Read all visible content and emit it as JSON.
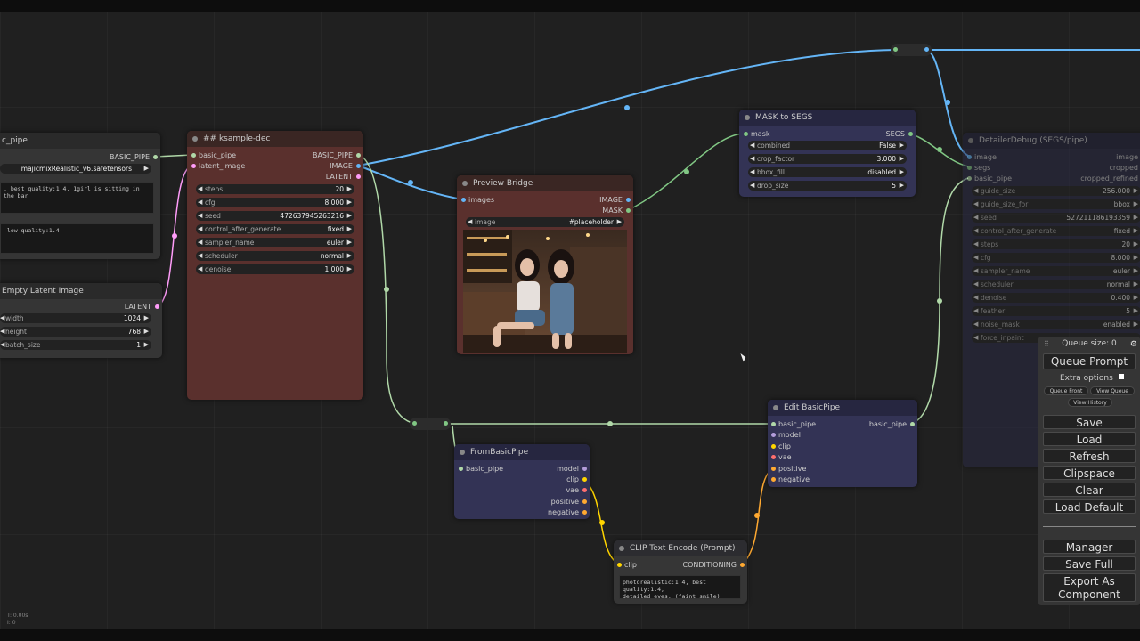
{
  "nodes": {
    "basic_pipe_loader": {
      "title": "c_pipe",
      "output": "BASIC_PIPE",
      "ckpt": "majicmixRealistic_v6.safetensors",
      "positive_text": ", best quality:1.4, 1girl is sitting in the bar",
      "negative_text": " low quality:1.4"
    },
    "empty_latent": {
      "title": "Empty Latent Image",
      "output": "LATENT",
      "widgets": [
        {
          "label": "width",
          "value": "1024"
        },
        {
          "label": "height",
          "value": "768"
        },
        {
          "label": "batch_size",
          "value": "1"
        }
      ]
    },
    "ksampler": {
      "title": "## ksample-dec",
      "inputs": [
        "basic_pipe",
        "latent_image"
      ],
      "outputs": [
        "BASIC_PIPE",
        "IMAGE",
        "LATENT"
      ],
      "widgets": [
        {
          "label": "steps",
          "value": "20"
        },
        {
          "label": "cfg",
          "value": "8.000"
        },
        {
          "label": "seed",
          "value": "472637945263216"
        },
        {
          "label": "control_after_generate",
          "value": "fixed"
        },
        {
          "label": "sampler_name",
          "value": "euler"
        },
        {
          "label": "scheduler",
          "value": "normal"
        },
        {
          "label": "denoise",
          "value": "1.000"
        }
      ]
    },
    "preview_bridge": {
      "title": "Preview Bridge",
      "input": "images",
      "outputs": [
        "IMAGE",
        "MASK"
      ],
      "image_label": "image",
      "image_value": "#placeholder"
    },
    "mask_to_segs": {
      "title": "MASK to SEGS",
      "input": "mask",
      "output": "SEGS",
      "widgets": [
        {
          "label": "combined",
          "value": "False"
        },
        {
          "label": "crop_factor",
          "value": "3.000"
        },
        {
          "label": "bbox_fill",
          "value": "disabled"
        },
        {
          "label": "drop_size",
          "value": "5"
        }
      ]
    },
    "detailer": {
      "title": "DetailerDebug (SEGS/pipe)",
      "inputs": [
        "image",
        "segs",
        "basic_pipe"
      ],
      "outputs": [
        "image",
        "cropped",
        "cropped_refined"
      ],
      "widgets": [
        {
          "label": "guide_size",
          "value": "256.000"
        },
        {
          "label": "guide_size_for",
          "value": "bbox"
        },
        {
          "label": "seed",
          "value": "527211186193359"
        },
        {
          "label": "control_after_generate",
          "value": "fixed"
        },
        {
          "label": "steps",
          "value": "20"
        },
        {
          "label": "cfg",
          "value": "8.000"
        },
        {
          "label": "sampler_name",
          "value": "euler"
        },
        {
          "label": "scheduler",
          "value": "normal"
        },
        {
          "label": "denoise",
          "value": "0.400"
        },
        {
          "label": "feather",
          "value": "5"
        },
        {
          "label": "noise_mask",
          "value": "enabled"
        },
        {
          "label": "force_inpaint",
          "value": ""
        }
      ]
    },
    "from_basic_pipe": {
      "title": "FromBasicPipe",
      "input": "basic_pipe",
      "outputs": [
        "model",
        "clip",
        "vae",
        "positive",
        "negative"
      ]
    },
    "edit_basic_pipe": {
      "title": "Edit BasicPipe",
      "inputs": [
        "basic_pipe",
        "model",
        "clip",
        "vae",
        "positive",
        "negative"
      ],
      "output": "basic_pipe"
    },
    "clip_text_encode": {
      "title": "CLIP Text Encode (Prompt)",
      "input": "clip",
      "output": "CONDITIONING",
      "text": "photorealistic:1.4, best quality:1.4,\ndetailed eyes, (faint smile)"
    }
  },
  "menu": {
    "queue_size": "Queue size: 0",
    "queue_prompt": "Queue Prompt",
    "extra_options": "Extra options",
    "queue_front": "Queue Front",
    "view_queue": "View Queue",
    "view_history": "View History",
    "save": "Save",
    "load": "Load",
    "refresh": "Refresh",
    "clipspace": "Clipspace",
    "clear": "Clear",
    "load_default": "Load Default",
    "manager": "Manager",
    "save_full": "Save Full",
    "export_component": "Export As Component"
  },
  "status": {
    "line1": "T: 0.00s",
    "line2": "I: 0"
  },
  "colors": {
    "image_link": "#64b5f6",
    "mask_link": "#81c784",
    "pipe_link": "#b0d8a8",
    "latent_link": "#ff9cf9",
    "clip_link": "#ffd500",
    "conditioning_link": "#ffa931"
  }
}
